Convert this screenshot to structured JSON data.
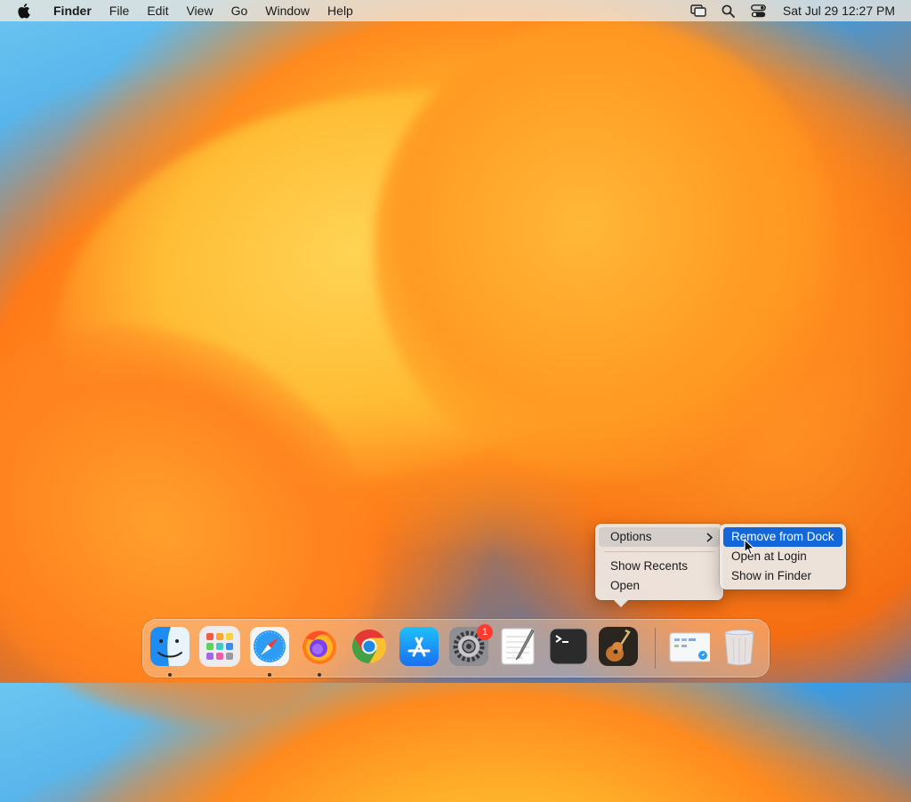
{
  "menubar": {
    "app_name": "Finder",
    "menus": [
      "File",
      "Edit",
      "View",
      "Go",
      "Window",
      "Help"
    ],
    "clock": "Sat Jul 29  12:27 PM",
    "status_icons": [
      "screen-mirroring-icon",
      "search-icon",
      "control-center-icon"
    ]
  },
  "context_menu": {
    "options_label": "Options",
    "show_recents_label": "Show Recents",
    "open_label": "Open"
  },
  "submenu": {
    "items": [
      "Remove from Dock",
      "Open at Login",
      "Show in Finder"
    ],
    "highlighted": "Remove from Dock"
  },
  "dock": {
    "apps": [
      "Finder",
      "Launchpad",
      "Safari",
      "Firefox",
      "Google Chrome",
      "App Store",
      "System Settings",
      "TextEdit",
      "Terminal",
      "GarageBand"
    ],
    "running": [
      "Finder",
      "Safari",
      "Firefox"
    ],
    "system_settings_badge": "1",
    "extras": [
      "Downloads stack",
      "Trash"
    ]
  },
  "colors": {
    "accent": "#1467d8",
    "badge": "#ff3b30"
  }
}
